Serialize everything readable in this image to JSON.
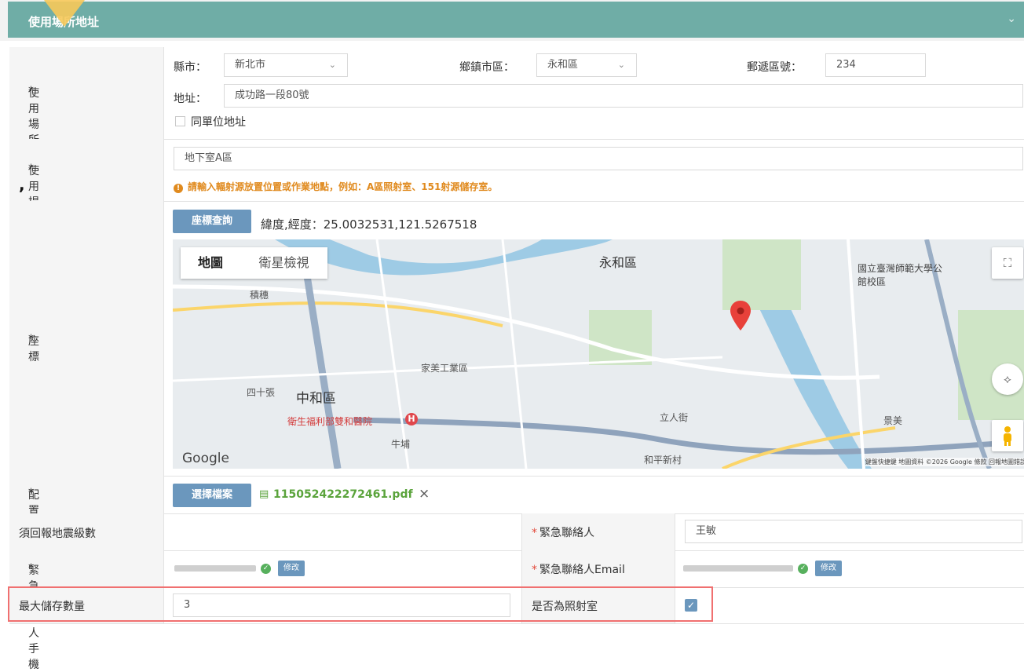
{
  "header": {
    "title": "使用場所地址"
  },
  "location": {
    "label": "使用場所位置",
    "county_label": "縣市：",
    "county_value": "新北市",
    "district_label": "鄉鎮市區：",
    "district_value": "永和區",
    "zip_label": "郵遞區號：",
    "zip_value": "234",
    "address_label": "地址：",
    "address_value": "成功路一段80號",
    "same_unit_label": "同單位地址"
  },
  "position": {
    "label": "使用場所位置",
    "value": "地下室A區",
    "hint": "請輸入輻射源放置位置或作業地點，例如：A區照射室、151射源儲存室。",
    "stray_mark": ","
  },
  "coords": {
    "label": "座標",
    "query_button": "座標查詢",
    "latlng_text": "緯度,經度：25.0032531,121.5267518",
    "map_tab_map": "地圖",
    "map_tab_satellite": "衛星檢視",
    "map_labels": [
      "永和區",
      "中和區",
      "四十張",
      "家美工業區",
      "衛生福利部雙和醫院",
      "國立臺灣師範大學公館校區",
      "積穗",
      "景美",
      "和平新村",
      "立人街",
      "牛埔"
    ],
    "map_footer": "鍵盤快捷鍵   地圖資料 ©2026 Google   條款   回報地圖錯誤",
    "google": "Google"
  },
  "floorplan": {
    "label": "配置平面圖",
    "button": "選擇檔案",
    "file": "115052422272461.pdf",
    "remove": "×"
  },
  "quake": {
    "label": "須回報地震級數"
  },
  "contact": {
    "label": "緊急聯絡人",
    "value": "王敏"
  },
  "phone": {
    "label": "緊急聯絡人手機",
    "edit": "修改"
  },
  "email": {
    "label": "緊急聯絡人Email",
    "edit": "修改"
  },
  "max_storage": {
    "label": "最大儲存數量",
    "value": "3"
  },
  "irradiation": {
    "label": "是否為照射室",
    "checked": true
  }
}
